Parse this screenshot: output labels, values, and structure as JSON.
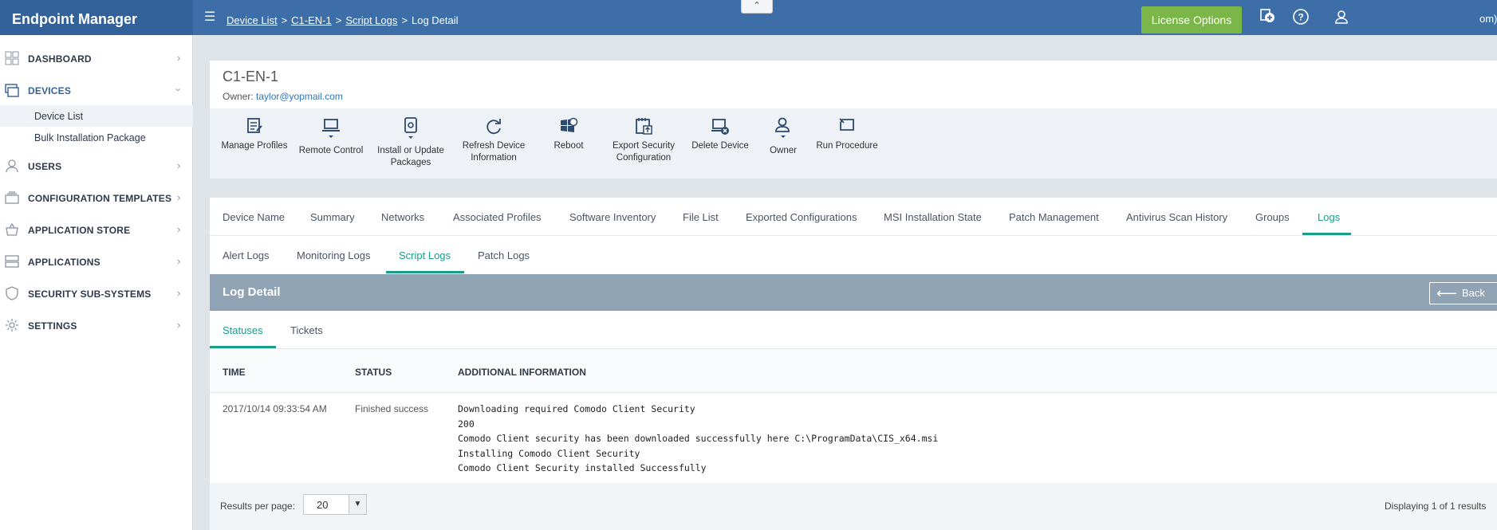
{
  "app": {
    "title": "Endpoint Manager"
  },
  "breadcrumb": [
    {
      "label": "Device List",
      "link": true
    },
    {
      "label": "C1-EN-1",
      "link": true
    },
    {
      "label": "Script Logs",
      "link": true
    },
    {
      "label": "Log Detail",
      "link": false
    }
  ],
  "header": {
    "license_button": "License Options",
    "user_truncated": "om)"
  },
  "sidebar": {
    "items": [
      {
        "label": "DASHBOARD",
        "icon": "dashboard-icon"
      },
      {
        "label": "DEVICES",
        "icon": "devices-icon",
        "expanded": true,
        "children": [
          {
            "label": "Device List",
            "active": true
          },
          {
            "label": "Bulk Installation Package"
          }
        ]
      },
      {
        "label": "USERS",
        "icon": "user-icon"
      },
      {
        "label": "CONFIGURATION TEMPLATES",
        "icon": "templates-icon"
      },
      {
        "label": "APPLICATION STORE",
        "icon": "store-icon"
      },
      {
        "label": "APPLICATIONS",
        "icon": "applications-icon"
      },
      {
        "label": "SECURITY SUB-SYSTEMS",
        "icon": "shield-icon"
      },
      {
        "label": "SETTINGS",
        "icon": "gear-icon"
      }
    ]
  },
  "device": {
    "name": "C1-EN-1",
    "owner_label": "Owner: ",
    "owner_email": "taylor@yopmail.com"
  },
  "toolbar": [
    {
      "line1": "Manage Profiles",
      "line2": ""
    },
    {
      "line1": "Remote Control",
      "line2": ""
    },
    {
      "line1": "Install or Update",
      "line2": "Packages"
    },
    {
      "line1": "Refresh Device",
      "line2": "Information"
    },
    {
      "line1": "Reboot",
      "line2": ""
    },
    {
      "line1": "Export Security",
      "line2": "Configuration"
    },
    {
      "line1": "Delete Device",
      "line2": ""
    },
    {
      "line1": "Owner",
      "line2": ""
    },
    {
      "line1": "Run Procedure",
      "line2": ""
    }
  ],
  "tabs": [
    "Device Name",
    "Summary",
    "Networks",
    "Associated Profiles",
    "Software Inventory",
    "File List",
    "Exported Configurations",
    "MSI Installation State",
    "Patch Management",
    "Antivirus Scan History",
    "Groups",
    "Logs"
  ],
  "active_tab": "Logs",
  "subtabs": [
    "Alert Logs",
    "Monitoring Logs",
    "Script Logs",
    "Patch Logs"
  ],
  "active_subtab": "Script Logs",
  "log_detail": {
    "title": "Log Detail",
    "back_label": "Back"
  },
  "status_tabs": [
    "Statuses",
    "Tickets"
  ],
  "active_status_tab": "Statuses",
  "table": {
    "columns": [
      "TIME",
      "STATUS",
      "ADDITIONAL INFORMATION"
    ],
    "rows": [
      {
        "time": "2017/10/14 09:33:54 AM",
        "status": "Finished success",
        "info": [
          "Downloading required Comodo Client Security",
          "200",
          "Comodo Client security has been downloaded successfully here C:\\ProgramData\\CIS_x64.msi",
          "Installing Comodo Client Security",
          "Comodo Client Security installed Successfully"
        ]
      }
    ]
  },
  "pagination": {
    "label": "Results per page:",
    "per_page": "20",
    "summary": "Displaying 1 of 1 results"
  },
  "colors": {
    "header": "#3d6ea8",
    "brand": "#33619a",
    "accent": "#1a9c8a",
    "license": "#7ab648",
    "log_bar": "#8fa3b4"
  }
}
